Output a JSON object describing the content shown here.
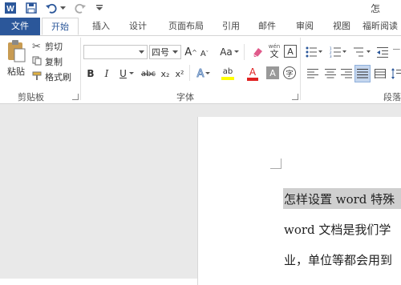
{
  "title_bar": {
    "app_title": "怎",
    "icons": [
      "word-logo-icon",
      "save-icon",
      "undo-icon",
      "undo-dropdown-icon",
      "redo-icon",
      "customize-toolbar-icon"
    ]
  },
  "tabs": [
    {
      "label": "文件"
    },
    {
      "label": "开始"
    },
    {
      "label": "插入"
    },
    {
      "label": "设计"
    },
    {
      "label": "页面布局"
    },
    {
      "label": "引用"
    },
    {
      "label": "邮件"
    },
    {
      "label": "审阅"
    },
    {
      "label": "视图"
    },
    {
      "label": "福昕阅读"
    }
  ],
  "clipboard": {
    "paste_label": "粘贴",
    "cut_label": "剪切",
    "copy_label": "复制",
    "format_painter_label": "格式刷",
    "group_label": "剪贴板"
  },
  "font": {
    "font_name_value": "",
    "font_size_value": "四号",
    "grow_label": "A",
    "shrink_label": "A",
    "case_label": "Aa",
    "phonetic_top": "wén",
    "phonetic_bottom": "文",
    "border_char_label": "A",
    "bold_label": "B",
    "italic_label": "I",
    "underline_label": "U",
    "strike_label": "abc",
    "subscript_label": "x₂",
    "superscript_label": "x²",
    "effects_label": "A",
    "highlight_label": "ab",
    "font_color_label": "A",
    "shading_label": "A",
    "enclose_label": "字",
    "group_label": "字体",
    "font_color": "#e02020",
    "highlight_color": "#ffff00"
  },
  "paragraph": {
    "group_label": "段落"
  },
  "document": {
    "line1": "怎样设置 word 特殊",
    "line2": "word  文档是我们学",
    "line3": "业，单位等都会用到"
  }
}
